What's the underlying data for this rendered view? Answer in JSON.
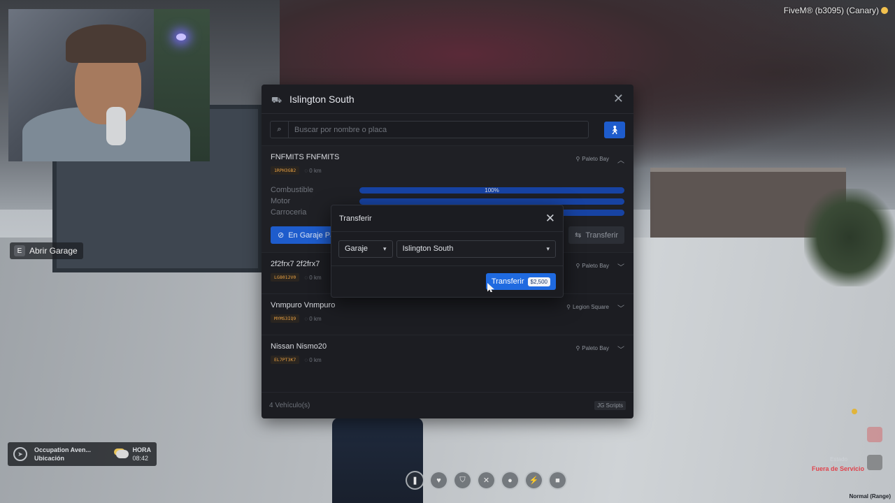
{
  "game": {
    "build_label": "FiveM® (b3095) (Canary)"
  },
  "hint": {
    "key": "E",
    "label": "Abrir Garage"
  },
  "garage": {
    "title": "Islington South",
    "search_placeholder": "Buscar por nombre o placa",
    "vehicles": [
      {
        "name": "FNFMITS FNFMITS",
        "plate": "1RPH3GB2",
        "km": "0 km",
        "location": "Paleto Bay",
        "expanded": true,
        "stats": [
          {
            "label": "Combustible",
            "value": 100,
            "display": "100%"
          },
          {
            "label": "Motor",
            "value": 100,
            "display": ""
          },
          {
            "label": "Carroceria",
            "value": 100,
            "display": ""
          }
        ],
        "status_button": "En Garaje Pa",
        "transfer_button": "Transferir"
      },
      {
        "name": "2f2frx7 2f2frx7",
        "plate": "LG8012V0",
        "km": "0 km",
        "location": "Paleto Bay"
      },
      {
        "name": "Vnmpuro Vnmpuro",
        "plate": "MYMS3IQ9",
        "km": "0 km",
        "location": "Legion Square"
      },
      {
        "name": "Nissan Nismo20",
        "plate": "EL7PT3K7",
        "km": "0 km",
        "location": "Paleto Bay"
      }
    ],
    "footer_count": "4 Vehículo(s)",
    "footer_brand": "JG Scripts"
  },
  "transfer_modal": {
    "title": "Transferir",
    "type_select": "Garaje",
    "target_select": "Islington South",
    "confirm_label": "Transferir",
    "price": "$2,500"
  },
  "location_hud": {
    "street": "Occupation Aven...",
    "label": "Ubicación",
    "time_label": "HORA",
    "time": "08:42"
  },
  "status_hud": {
    "estado_label": "Estado",
    "estado_value": "Fuera de Servicio",
    "mode": "Normal (Range)"
  },
  "colors": {
    "accent": "#1e5ccc",
    "bar": "#1743a3",
    "danger": "#e0434c",
    "plate": "#e8a042"
  }
}
